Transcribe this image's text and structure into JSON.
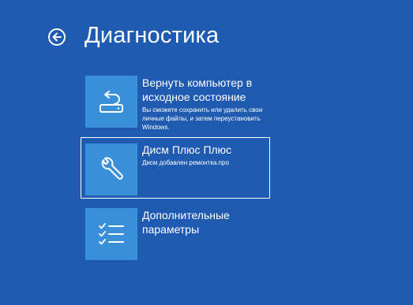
{
  "header": {
    "title": "Диагностика",
    "back_icon": "back-arrow-icon"
  },
  "options": [
    {
      "title": "Вернуть компьютер в исходное состояние",
      "description": "Вы сможете сохранить или удалить свои личные файлы, и затем переустановить Windows.",
      "icon": "reset-pc-icon"
    },
    {
      "title": "Дисм Плюс Плюс",
      "description": "Дисм добавлен ремонтка.про",
      "icon": "wrench-icon",
      "selected": true
    },
    {
      "title": "Дополнительные параметры",
      "description": "",
      "icon": "checklist-icon"
    }
  ],
  "colors": {
    "background": "#1f5bb0",
    "tile": "#3a8fd9",
    "text": "#ffffff"
  }
}
